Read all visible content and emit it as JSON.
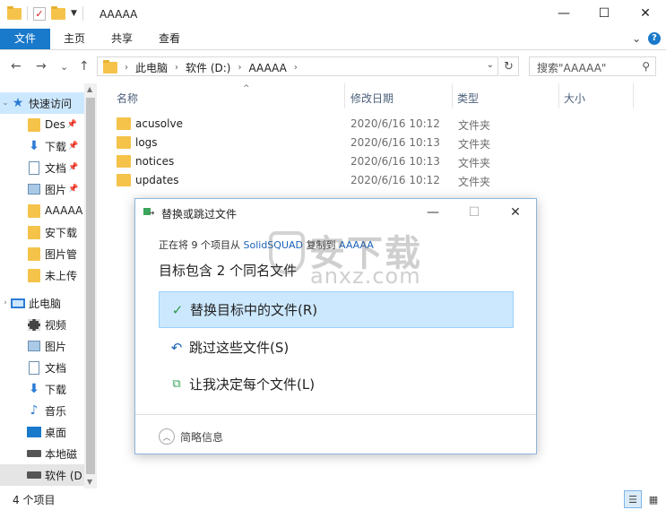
{
  "window": {
    "title": "AAAAA",
    "minimize": "—",
    "maximize": "☐",
    "close": "✕"
  },
  "ribbon": {
    "tabs": [
      "文件",
      "主页",
      "共享",
      "查看"
    ],
    "collapse": "⌄",
    "help": "?"
  },
  "address": {
    "back": "←",
    "forward": "→",
    "recent": "⌄",
    "up": "↑",
    "crumbs": [
      "此电脑",
      "软件 (D:)",
      "AAAAA"
    ],
    "separator": "›",
    "search_placeholder": "搜索\"AAAAA\""
  },
  "navpane": {
    "quick_access": "快速访问",
    "items": [
      {
        "label": "Des",
        "icon": "folder-icon",
        "pinned": true
      },
      {
        "label": "下载",
        "icon": "download-icon",
        "pinned": true
      },
      {
        "label": "文档",
        "icon": "document-icon",
        "pinned": true
      },
      {
        "label": "图片",
        "icon": "picture-icon",
        "pinned": true
      },
      {
        "label": "AAAAA",
        "icon": "folder-icon",
        "pinned": false
      },
      {
        "label": "安下载",
        "icon": "folder-icon",
        "pinned": false
      },
      {
        "label": "图片管",
        "icon": "folder-icon",
        "pinned": false
      },
      {
        "label": "未上传",
        "icon": "folder-icon",
        "pinned": false
      }
    ],
    "this_pc": "此电脑",
    "pc_items": [
      {
        "label": "视频",
        "icon": "video-icon"
      },
      {
        "label": "图片",
        "icon": "picture-icon"
      },
      {
        "label": "文档",
        "icon": "document-icon"
      },
      {
        "label": "下载",
        "icon": "download-icon"
      },
      {
        "label": "音乐",
        "icon": "music-icon"
      },
      {
        "label": "桌面",
        "icon": "desktop-icon"
      },
      {
        "label": "本地磁",
        "icon": "drive-icon"
      },
      {
        "label": "软件 (D",
        "icon": "drive-icon"
      }
    ]
  },
  "columns": {
    "name": "名称",
    "date": "修改日期",
    "type": "类型",
    "size": "大小"
  },
  "files": [
    {
      "name": "acusolve",
      "date": "2020/6/16 10:12",
      "type": "文件夹"
    },
    {
      "name": "logs",
      "date": "2020/6/16 10:13",
      "type": "文件夹"
    },
    {
      "name": "notices",
      "date": "2020/6/16 10:13",
      "type": "文件夹"
    },
    {
      "name": "updates",
      "date": "2020/6/16 10:12",
      "type": "文件夹"
    }
  ],
  "status": {
    "count": "4 个项目"
  },
  "dialog": {
    "title": "替换或跳过文件",
    "progress_prefix": "正在将 9 个项目从",
    "source": "SolidSQUAD",
    "progress_mid": "复制到",
    "dest": "AAAAA",
    "heading": "目标包含 2 个同名文件",
    "options": [
      {
        "label": "替换目标中的文件(R)",
        "icon": "check-icon"
      },
      {
        "label": "跳过这些文件(S)",
        "icon": "undo-icon"
      },
      {
        "label": "让我决定每个文件(L)",
        "icon": "copy-icon"
      }
    ],
    "footer": "简略信息",
    "minimize": "—",
    "maximize": "☐",
    "close": "✕"
  },
  "watermark": {
    "cn": "安下载",
    "en": "anxz.com"
  },
  "colors": {
    "accent": "#1979ca",
    "selection": "#cce8ff",
    "folder": "#f5c34a"
  }
}
